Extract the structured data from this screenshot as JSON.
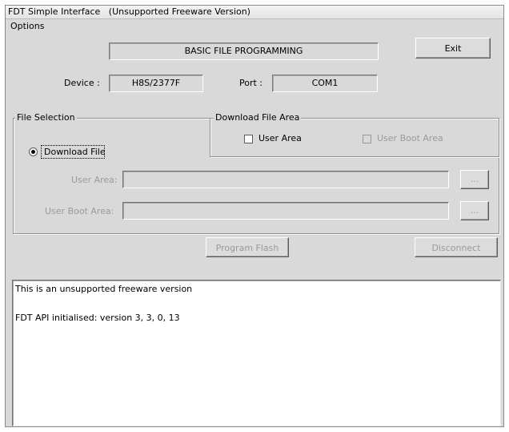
{
  "window": {
    "title": "FDT Simple Interface   (Unsupported Freeware Version)"
  },
  "menu": {
    "items": [
      "Options"
    ]
  },
  "header": {
    "title": "BASIC FILE PROGRAMMING",
    "exit_label": "Exit"
  },
  "connection": {
    "device_label": "Device :",
    "device_value": "H8S/2377F",
    "port_label": "Port :",
    "port_value": "COM1"
  },
  "file_selection": {
    "title": "File Selection",
    "download_file_label": "Download File",
    "download_file_selected": true
  },
  "download_area": {
    "title": "Download File Area",
    "user_area_label": "User Area",
    "user_area_checked": false,
    "user_boot_area_label": "User Boot Area",
    "user_boot_area_checked": false,
    "user_boot_area_enabled": false
  },
  "files": {
    "user_area_label": "User Area:",
    "user_area_value": "",
    "user_area_browse": "...",
    "user_boot_area_label": "User Boot Area:",
    "user_boot_area_value": "",
    "user_boot_area_browse": "..."
  },
  "actions": {
    "program_flash_label": "Program Flash",
    "disconnect_label": "Disconnect"
  },
  "log": {
    "lines": [
      "This is an unsupported freeware version",
      "FDT API initialised: version 3, 3, 0, 13"
    ]
  }
}
